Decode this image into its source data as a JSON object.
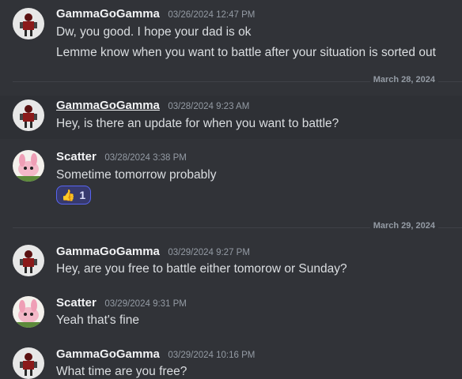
{
  "users": {
    "gamma": "GammaGoGamma",
    "scatter": "Scatter"
  },
  "messages": [
    {
      "user": "GammaGoGamma",
      "time": "03/26/2024 12:47 PM",
      "lines": [
        "Dw, you good. I hope your dad is ok",
        "Lemme know when you want to battle after your situation is sorted out"
      ]
    },
    {
      "user": "GammaGoGamma",
      "time": "03/28/2024 9:23 AM",
      "lines": [
        "Hey, is there an update for when you want to battle?"
      ]
    },
    {
      "user": "Scatter",
      "time": "03/28/2024 3:38 PM",
      "lines": [
        "Sometime tomorrow probably"
      ],
      "reaction": {
        "emoji": "👍",
        "count": "1"
      }
    },
    {
      "user": "GammaGoGamma",
      "time": "03/29/2024 9:27 PM",
      "lines": [
        "Hey, are you free to battle either tomorow or Sunday?"
      ]
    },
    {
      "user": "Scatter",
      "time": "03/29/2024 9:31 PM",
      "lines": [
        "Yeah that's fine"
      ]
    },
    {
      "user": "GammaGoGamma",
      "time": "03/29/2024 10:16 PM",
      "lines": [
        "What time are you free?"
      ]
    }
  ],
  "dividers": [
    "March 28, 2024",
    "March 29, 2024"
  ],
  "colors": {
    "background": "#313338",
    "reaction_border": "#5865f2",
    "muted_text": "#949ba4"
  }
}
